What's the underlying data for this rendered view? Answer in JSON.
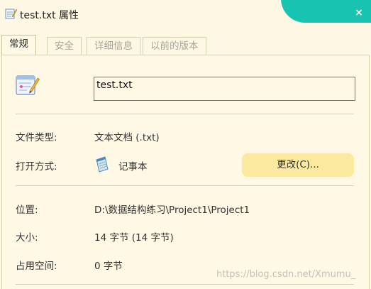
{
  "window": {
    "title": "test.txt 属性",
    "close_label": "×",
    "accent_color": "#19c3b1"
  },
  "tabs": [
    {
      "label": "常规",
      "active": true
    },
    {
      "label": "安全",
      "active": false
    },
    {
      "label": "详细信息",
      "active": false
    },
    {
      "label": "以前的版本",
      "active": false
    }
  ],
  "general": {
    "file_name": "test.txt",
    "file_icon": "text-file-icon",
    "file_type_label": "文件类型:",
    "file_type_value": "文本文档 (.txt)",
    "opens_with_label": "打开方式:",
    "opens_with_value": "记事本",
    "opens_with_icon": "notepad-icon",
    "change_button": "更改(C)...",
    "location_label": "位置:",
    "location_value": "D:\\数据结构练习\\Project1\\Project1",
    "size_label": "大小:",
    "size_value": "14 字节 (14 字节)",
    "disk_size_label": "占用空间:",
    "disk_size_value": "0 字节"
  },
  "watermark": "https://blog.csdn.net/Xmumu_"
}
